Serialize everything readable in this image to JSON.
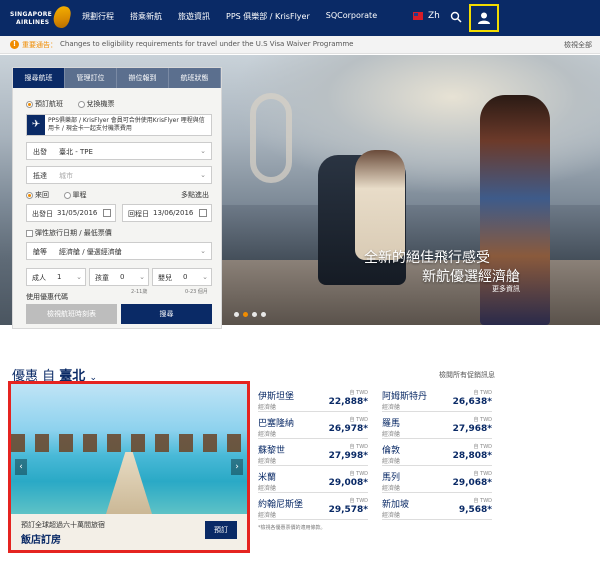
{
  "brand": {
    "line1": "SINGAPORE",
    "line2": "AIRLINES"
  },
  "nav": [
    "規劃行程",
    "搭乘新航",
    "旅遊資訊",
    "PPS 俱樂部 / KrisFlyer",
    "SQCorporate"
  ],
  "language": "Zh",
  "notice": {
    "label": "重要通告：",
    "message": "Changes to eligibility requirements for travel under the U.S Visa Waiver Programme",
    "view_all": "檢視全部"
  },
  "booking": {
    "tabs": [
      "搜尋航班",
      "管理訂位",
      "辦位報到",
      "航班狀態"
    ],
    "trip_options": [
      "預訂航班",
      "兌換機票"
    ],
    "pps_notice": "PPS俱樂部 / KrisFlyer 會員可合併使用KrisFlyer 哩程與信用卡 / 現金卡一起支付機票費用",
    "from_label": "出發",
    "from_value": "臺北 - TPE",
    "to_label": "抵達",
    "to_placeholder": "城市",
    "journey_options": [
      "來回",
      "單程"
    ],
    "multi_city": "多點進出",
    "depart_label": "出發日",
    "depart_value": "31/05/2016",
    "return_label": "回程日",
    "return_value": "13/06/2016",
    "flexible": "彈性旅行日期 / 最低票價",
    "class_label": "艙等",
    "class_value": "經濟艙 / 優選經濟艙",
    "adult_label": "成人",
    "adult_value": "1",
    "child_label": "孩童",
    "child_value": "0",
    "child_note": "2-11歲",
    "infant_label": "嬰兒",
    "infant_value": "0",
    "infant_note": "0-23 個月",
    "promo_code": "使用優惠代碼",
    "timetable_button": "檢視航班時刻表",
    "search_button": "搜尋"
  },
  "hero": {
    "title": "全新的絕佳飛行感受",
    "subtitle": "新航優選經濟艙",
    "more": "更多資訊"
  },
  "deals": {
    "heading": "優惠 自",
    "city": "臺北",
    "view_all": "檢閱所有促銷訊息",
    "promo_line1": "預訂全球超過六十萬間旅宿",
    "promo_line2": "飯店訂房",
    "promo_button": "預訂",
    "fares": [
      {
        "dest": "伊斯坦堡",
        "cls": "經濟艙",
        "from": "自 TWD",
        "price": "22,888*"
      },
      {
        "dest": "阿姆斯特丹",
        "cls": "經濟艙",
        "from": "自 TWD",
        "price": "26,638*"
      },
      {
        "dest": "巴塞隆納",
        "cls": "經濟艙",
        "from": "自 TWD",
        "price": "26,978*"
      },
      {
        "dest": "羅馬",
        "cls": "經濟艙",
        "from": "自 TWD",
        "price": "27,968*"
      },
      {
        "dest": "蘇黎世",
        "cls": "經濟艙",
        "from": "自 TWD",
        "price": "27,998*"
      },
      {
        "dest": "倫敦",
        "cls": "經濟艙",
        "from": "自 TWD",
        "price": "28,808*"
      },
      {
        "dest": "米蘭",
        "cls": "經濟艙",
        "from": "自 TWD",
        "price": "29,008*"
      },
      {
        "dest": "馬列",
        "cls": "經濟艙",
        "from": "自 TWD",
        "price": "29,068*"
      },
      {
        "dest": "約翰尼斯堡",
        "cls": "經濟艙",
        "from": "自 TWD",
        "price": "29,578*"
      },
      {
        "dest": "新加坡",
        "cls": "經濟艙",
        "from": "自 TWD",
        "price": "9,568*"
      }
    ],
    "fares_note": "*檢視各優惠票價的適用條款。"
  }
}
